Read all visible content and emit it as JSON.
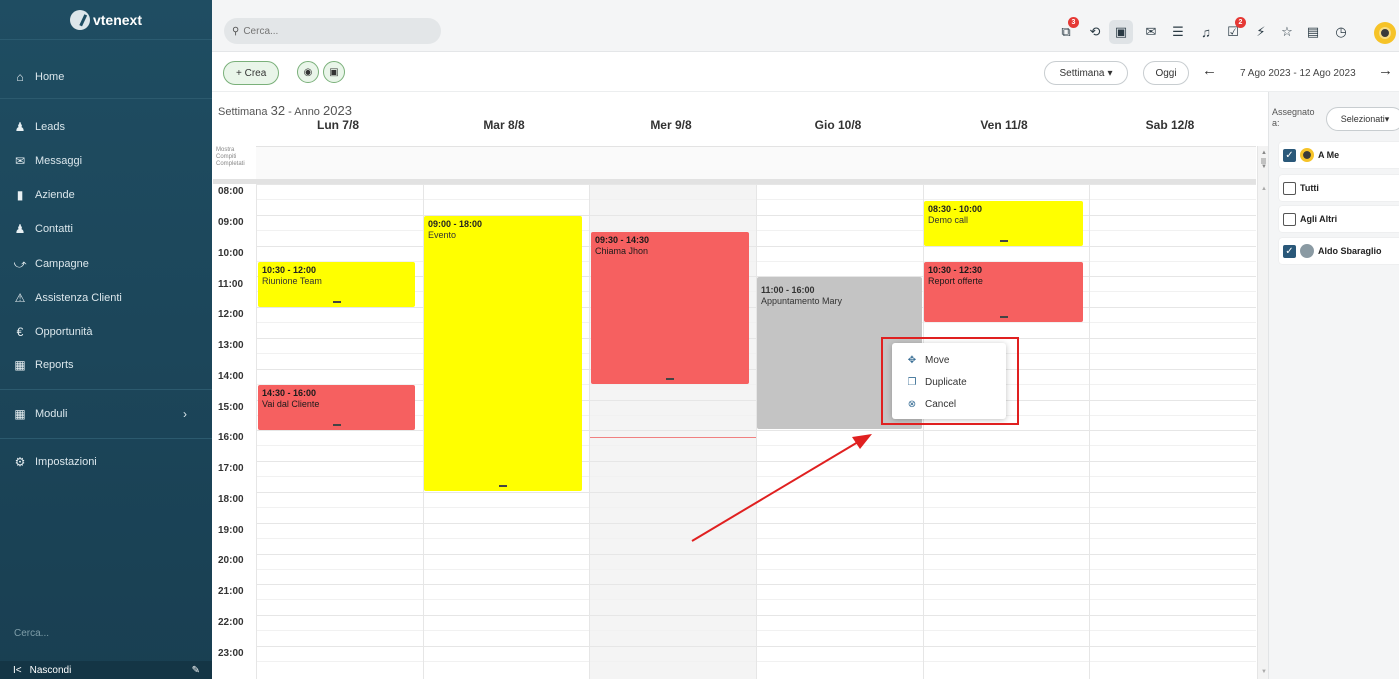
{
  "app": {
    "name": "vtenext"
  },
  "sidebar": {
    "items": [
      {
        "label": "Home",
        "icon": "home-icon"
      },
      {
        "label": "Leads",
        "icon": "user-icon"
      },
      {
        "label": "Messaggi",
        "icon": "mail-icon"
      },
      {
        "label": "Aziende",
        "icon": "building-icon"
      },
      {
        "label": "Contatti",
        "icon": "contact-icon"
      },
      {
        "label": "Campagne",
        "icon": "trend-icon"
      },
      {
        "label": "Assistenza Clienti",
        "icon": "warning-icon"
      },
      {
        "label": "Opportunità",
        "icon": "euro-icon"
      },
      {
        "label": "Reports",
        "icon": "table-icon"
      },
      {
        "label": "Moduli",
        "icon": "grid-icon"
      },
      {
        "label": "Impostazioni",
        "icon": "gear-icon"
      }
    ],
    "search_placeholder": "Cerca...",
    "hide_label": "Nascondi"
  },
  "topbar": {
    "search_placeholder": "Cerca...",
    "badges": {
      "processes": "3",
      "tasks": "2"
    }
  },
  "toolbar": {
    "create_label": "+ Crea",
    "view_label": "Settimana",
    "today_label": "Oggi",
    "date_range": "7 Ago 2023 - 12 Ago 2023"
  },
  "calendar": {
    "week_prefix": "Settimana",
    "week_number": "32",
    "year_prefix": "- Anno",
    "year": "2023",
    "days": [
      "Lun 7/8",
      "Mar 8/8",
      "Mer 9/8",
      "Gio 10/8",
      "Ven 11/8",
      "Sab 12/8"
    ],
    "allday_label": "Mostra Compiti Completati",
    "hours": [
      "08:00",
      "09:00",
      "10:00",
      "11:00",
      "12:00",
      "13:00",
      "14:00",
      "15:00",
      "16:00",
      "17:00",
      "18:00",
      "19:00",
      "20:00",
      "21:00",
      "22:00",
      "23:00"
    ],
    "events": [
      {
        "time": "10:30 - 12:00",
        "title": "Riunione Team",
        "color": "#ffff00"
      },
      {
        "time": "14:30 - 16:00",
        "title": "Vai dal Cliente",
        "color": "#f66060"
      },
      {
        "time": "09:00 - 18:00",
        "title": "Evento",
        "color": "#ffff00"
      },
      {
        "time": "09:30 - 14:30",
        "title": "Chiama Jhon",
        "color": "#f66060"
      },
      {
        "time": "11:00 - 16:00",
        "title": "Appuntamento Mary",
        "color": "#c4c4c4"
      },
      {
        "time": "08:30 - 10:00",
        "title": "Demo call",
        "color": "#ffff00"
      },
      {
        "time": "10:30 - 12:30",
        "title": "Report offerte",
        "color": "#f66060"
      }
    ]
  },
  "context_menu": {
    "items": [
      {
        "label": "Move",
        "icon": "move-icon"
      },
      {
        "label": "Duplicate",
        "icon": "duplicate-icon"
      },
      {
        "label": "Cancel",
        "icon": "cancel-icon"
      }
    ]
  },
  "right_panel": {
    "assigned_label": "Assegnato a:",
    "select_label": "Selezionati",
    "items": [
      {
        "label": "A Me",
        "checked": true,
        "color": "#ffff00"
      },
      {
        "label": "Tutti",
        "checked": false
      },
      {
        "label": "Agli Altri",
        "checked": false
      },
      {
        "label": "Aldo Sbaraglio",
        "checked": true,
        "color": "#f66060"
      }
    ]
  }
}
